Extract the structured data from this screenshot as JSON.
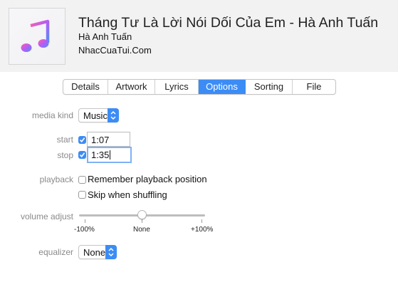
{
  "track": {
    "title": "Tháng Tư Là Lời Nói Dối Của Em - Hà Anh Tuấn",
    "artist": "Hà Anh Tuấn",
    "album": "NhacCuaTui.Com",
    "artwork_icon": "music-note-icon"
  },
  "tabs": [
    {
      "label": "Details",
      "active": false
    },
    {
      "label": "Artwork",
      "active": false
    },
    {
      "label": "Lyrics",
      "active": false
    },
    {
      "label": "Options",
      "active": true
    },
    {
      "label": "Sorting",
      "active": false
    },
    {
      "label": "File",
      "active": false
    }
  ],
  "options": {
    "media_kind": {
      "label": "media kind",
      "value": "Music"
    },
    "start": {
      "label": "start",
      "checked": true,
      "value": "1:07"
    },
    "stop": {
      "label": "stop",
      "checked": true,
      "value": "1:35"
    },
    "playback": {
      "label": "playback",
      "remember": {
        "label": "Remember playback position",
        "checked": false
      },
      "skip": {
        "label": "Skip when shuffling",
        "checked": false
      }
    },
    "volume_adjust": {
      "label": "volume adjust",
      "value_percent": 0,
      "min_label": "-100%",
      "mid_label": "None",
      "max_label": "+100%"
    },
    "equalizer": {
      "label": "equalizer",
      "value": "None"
    }
  },
  "colors": {
    "accent": "#3c8cf5",
    "header_bg": "#f2f2f2",
    "label": "#8a8a8a"
  }
}
